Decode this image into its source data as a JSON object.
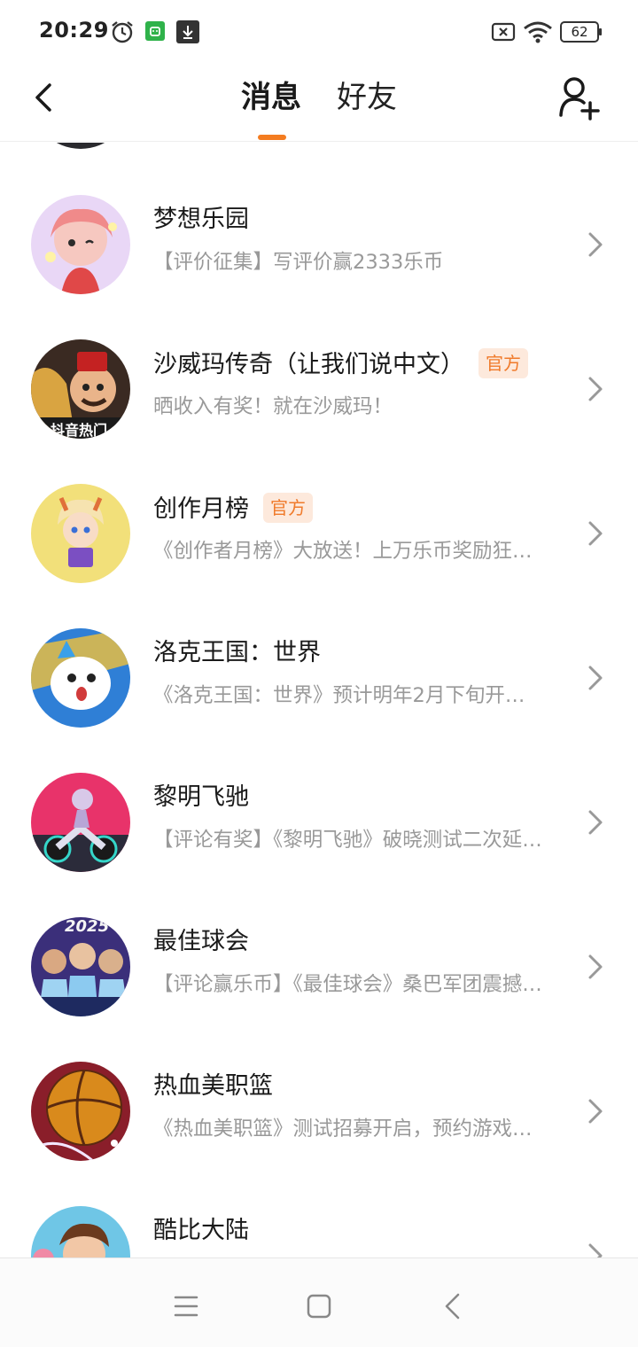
{
  "status_bar": {
    "time": "20:29",
    "battery": "62",
    "icons": [
      "alarm-icon",
      "app-icon",
      "download-icon",
      "sim-off-icon",
      "wifi-icon",
      "battery-icon"
    ]
  },
  "header": {
    "tabs": [
      {
        "label": "消息",
        "active": true
      },
      {
        "label": "好友",
        "active": false
      }
    ],
    "accent_color": "#f47c20"
  },
  "conversations": [
    {
      "title": "梦想乐园",
      "subtitle": "【评价征集】写评价赢2333乐币",
      "badge": ""
    },
    {
      "title": "沙威玛传奇（让我们说中文）",
      "subtitle": "晒收入有奖！就在沙威玛！",
      "badge": "官方",
      "avatar_text": "抖音热门"
    },
    {
      "title": "创作月榜",
      "subtitle": "《创作者月榜》大放送！上万乐币奖励狂…",
      "badge": "官方"
    },
    {
      "title": "洛克王国：世界",
      "subtitle": "《洛克王国：世界》预计明年2月下旬开…",
      "badge": ""
    },
    {
      "title": "黎明飞驰",
      "subtitle": "【评论有奖】《黎明飞驰》破晓测试二次延…",
      "badge": ""
    },
    {
      "title": "最佳球会",
      "subtitle": "【评论赢乐币】《最佳球会》桑巴军团震撼…",
      "badge": "",
      "avatar_text": "2025"
    },
    {
      "title": "热血美职篮",
      "subtitle": "《热血美职篮》测试招募开启，预约游戏…",
      "badge": ""
    },
    {
      "title": "酷比大陆",
      "subtitle": "",
      "badge": ""
    }
  ],
  "colors": {
    "badge_text": "#f07a2a",
    "badge_bg": "#fde9dc",
    "subtitle": "#999999"
  }
}
